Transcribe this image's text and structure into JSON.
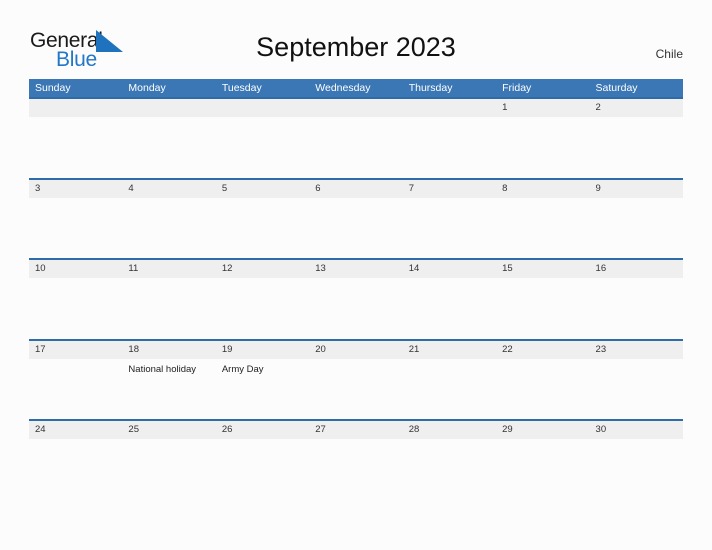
{
  "brand": {
    "word_one": "General",
    "word_two": "Blue",
    "mark": "triangle-flag-icon",
    "color_dark": "#1a1a1a",
    "color_blue": "#2277c8"
  },
  "header": {
    "title": "September 2023",
    "region": "Chile"
  },
  "theme": {
    "header_blue": "#3b77b5",
    "band_border_blue": "#2d6ca8",
    "band_fill": "#efefef",
    "page_background": "#fcfcfc"
  },
  "calendar": {
    "weekdays": [
      "Sunday",
      "Monday",
      "Tuesday",
      "Wednesday",
      "Thursday",
      "Friday",
      "Saturday"
    ],
    "weeks": [
      {
        "days": [
          {
            "date": "",
            "event": ""
          },
          {
            "date": "",
            "event": ""
          },
          {
            "date": "",
            "event": ""
          },
          {
            "date": "",
            "event": ""
          },
          {
            "date": "",
            "event": ""
          },
          {
            "date": "1",
            "event": ""
          },
          {
            "date": "2",
            "event": ""
          }
        ]
      },
      {
        "days": [
          {
            "date": "3",
            "event": ""
          },
          {
            "date": "4",
            "event": ""
          },
          {
            "date": "5",
            "event": ""
          },
          {
            "date": "6",
            "event": ""
          },
          {
            "date": "7",
            "event": ""
          },
          {
            "date": "8",
            "event": ""
          },
          {
            "date": "9",
            "event": ""
          }
        ]
      },
      {
        "days": [
          {
            "date": "10",
            "event": ""
          },
          {
            "date": "11",
            "event": ""
          },
          {
            "date": "12",
            "event": ""
          },
          {
            "date": "13",
            "event": ""
          },
          {
            "date": "14",
            "event": ""
          },
          {
            "date": "15",
            "event": ""
          },
          {
            "date": "16",
            "event": ""
          }
        ]
      },
      {
        "days": [
          {
            "date": "17",
            "event": ""
          },
          {
            "date": "18",
            "event": "National holiday"
          },
          {
            "date": "19",
            "event": "Army Day"
          },
          {
            "date": "20",
            "event": ""
          },
          {
            "date": "21",
            "event": ""
          },
          {
            "date": "22",
            "event": ""
          },
          {
            "date": "23",
            "event": ""
          }
        ]
      },
      {
        "days": [
          {
            "date": "24",
            "event": ""
          },
          {
            "date": "25",
            "event": ""
          },
          {
            "date": "26",
            "event": ""
          },
          {
            "date": "27",
            "event": ""
          },
          {
            "date": "28",
            "event": ""
          },
          {
            "date": "29",
            "event": ""
          },
          {
            "date": "30",
            "event": ""
          }
        ]
      }
    ]
  }
}
